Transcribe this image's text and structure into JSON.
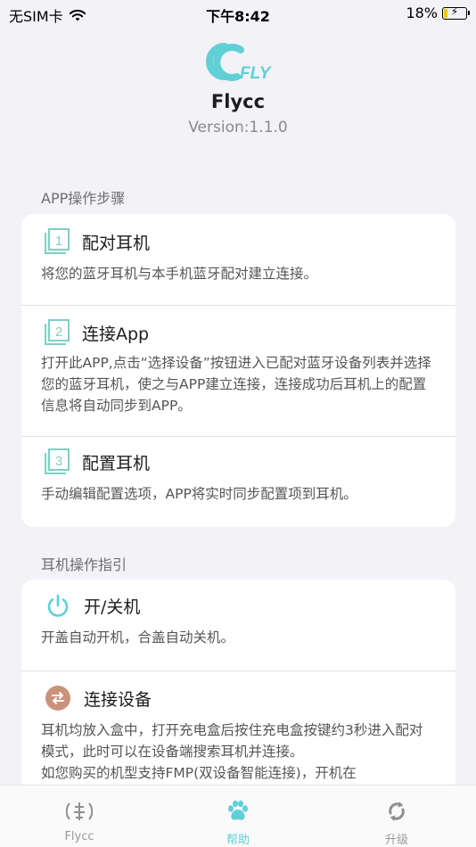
{
  "status_bar": {
    "carrier": "无SIM卡",
    "time": "下午8:42",
    "battery": "18%",
    "battery_level": 0.18
  },
  "header": {
    "logo_text": "FLY",
    "app_name": "Flycc",
    "version": "Version:1.1.0"
  },
  "app_section": {
    "title": "APP操作步骤",
    "steps": [
      {
        "number": "1",
        "title": "配对耳机",
        "desc": "将您的蓝牙耳机与本手机蓝牙配对建立连接。"
      },
      {
        "number": "2",
        "title": "连接App",
        "desc": "打开此APP,点击“选择设备”按钮进入已配对蓝牙设备列表并选择您的蓝牙耳机，使之与APP建立连接，连接成功后耳机上的配置信息将自动同步到APP。"
      },
      {
        "number": "3",
        "title": "配置耳机",
        "desc": "手动编辑配置选项，APP将实时同步配置项到耳机。"
      }
    ]
  },
  "earphone_section": {
    "title": "耳机操作指引",
    "items": [
      {
        "title": "开/关机",
        "desc": "开盖自动开机，合盖自动关机。",
        "icon": "power-icon"
      },
      {
        "title": "连接设备",
        "desc": "耳机均放入盒中，打开充电盒后按住充电盒按键约3秒进入配对模式，此时可以在设备端搜索耳机并连接。",
        "desc_more": "如您购买的机型支持FMP(双设备智能连接)，开机在",
        "icon": "swap-icon"
      }
    ]
  },
  "tabs": [
    {
      "label": "Flycc",
      "icon": "radar-icon",
      "active": false
    },
    {
      "label": "帮助",
      "icon": "paw-icon",
      "active": true
    },
    {
      "label": "升级",
      "icon": "refresh-icon",
      "active": false
    }
  ],
  "colors": {
    "accent": "#5fd0d6",
    "background": "#f2f2f7",
    "connect_icon": "#c9927a"
  }
}
